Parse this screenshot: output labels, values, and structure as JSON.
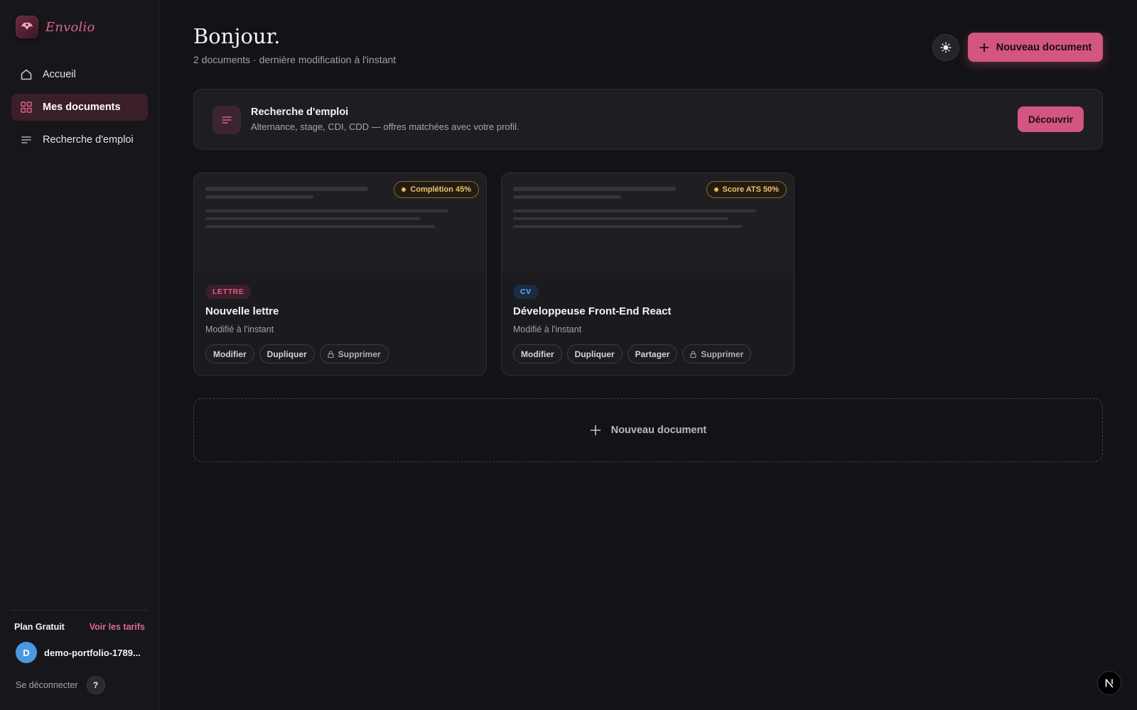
{
  "brand": {
    "name": "Envolio"
  },
  "sidebar": {
    "items": [
      {
        "label": "Accueil",
        "icon": "home-icon",
        "active": false
      },
      {
        "label": "Mes documents",
        "icon": "grid-icon",
        "active": true
      },
      {
        "label": "Recherche d'emploi",
        "icon": "lines-icon",
        "active": false
      }
    ],
    "plan": {
      "name": "Plan Gratuit",
      "link": "Voir les tarifs"
    },
    "user": {
      "initial": "D",
      "name": "demo-portfolio-1789..."
    },
    "logout": "Se déconnecter",
    "help": "?"
  },
  "header": {
    "title": "Bonjour.",
    "subtitle": "2 documents · dernière modification à l'instant",
    "new_button": "Nouveau document"
  },
  "banner": {
    "title": "Recherche d'emploi",
    "description": "Alternance, stage, CDI, CDD — offres matchées avec votre profil.",
    "button": "Découvrir"
  },
  "documents": [
    {
      "tag": "LETTRE",
      "title": "Nouvelle lettre",
      "modified": "Modifié à l'instant",
      "badge": "Complétion 45%",
      "badge_value": 45,
      "actions": [
        "Modifier",
        "Dupliquer",
        "Supprimer"
      ]
    },
    {
      "tag": "CV",
      "title": "Développeuse Front-End React",
      "modified": "Modifié à l'instant",
      "badge": "Score ATS 50%",
      "badge_value": 50,
      "actions": [
        "Modifier",
        "Dupliquer",
        "Partager",
        "Supprimer"
      ]
    }
  ],
  "new_document": "Nouveau document",
  "colors": {
    "accent": "#d2567f",
    "background": "#131317",
    "badge": "#f1c56a",
    "cv_tag": "#6aaeea"
  }
}
